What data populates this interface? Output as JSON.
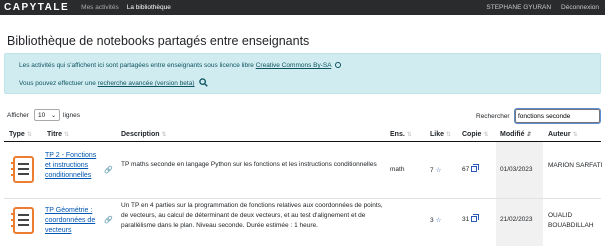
{
  "navbar": {
    "brand": "CAPYTALE",
    "links": [
      "Mes activités",
      "La bibliothèque"
    ],
    "user": "STEPHANE GYURAN",
    "logout": "Déconnexion"
  },
  "page_title": "Bibliothèque de notebooks partagés entre enseignants",
  "info": {
    "line1_text": "Les activités qui s'affichent ici sont partagées entre enseignants sous licence libre",
    "line1_link": "Creative Commons By-SA",
    "line2_text": "Vous pouvez effectuer une",
    "line2_link": "recherche avancée (version beta)"
  },
  "controls": {
    "show_label": "Afficher",
    "page_length": "10",
    "entries_label": "lignes",
    "search_label": "Rechercher",
    "search_value": "fonctions seconde"
  },
  "columns": [
    "Type",
    "Titre",
    "Description",
    "Ens.",
    "Like",
    "Copie",
    "Modifié",
    "Auteur"
  ],
  "rows": [
    {
      "title": "TP 2 - Fonctions et instructions conditionnelles",
      "description": "TP maths seconde en langage Python sur les fonctions et les instructions conditionnelles",
      "subject": "math",
      "likes": "7",
      "copies": "67",
      "modified": "01/03/2023",
      "author": "MARION SARFATI"
    },
    {
      "title": "TP Géométrie : coordonnées de vecteurs",
      "description": "Un TP en 4 parties sur la programmation de fonctions relatives aux coordonnées de points, de vecteurs, au calcul de déterminant de deux vecteurs, et au test d'alignement et de parallélisme dans le plan. Niveau seconde. Durée estimée : 1 heure.",
      "subject": "",
      "likes": "3",
      "copies": "31",
      "modified": "21/02/2023",
      "author": "OUALID BOUABDILLAH"
    }
  ],
  "colors": {
    "navbar": "#292b2c",
    "info_bg": "#d1ecf1",
    "info_text": "#0c5460",
    "link": "#0056b3",
    "icon_accent": "#ed7d31"
  },
  "icons": [
    "notebook-icon",
    "link-icon",
    "star-icon",
    "copy-icon",
    "search-icon",
    "creative-commons-icon",
    "sort-icon"
  ]
}
